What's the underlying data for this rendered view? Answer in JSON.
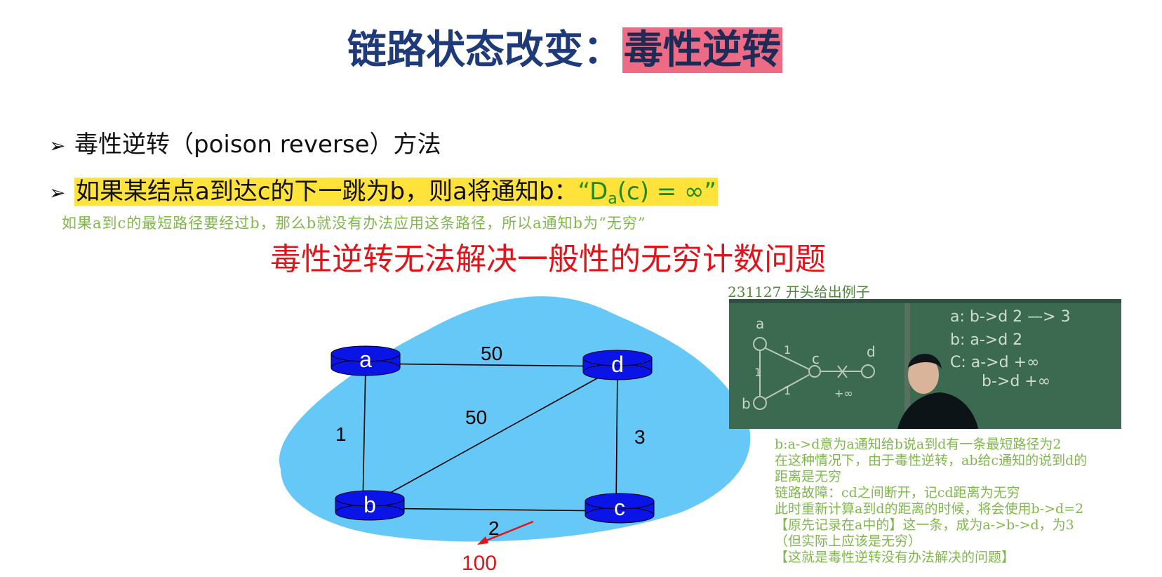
{
  "title": {
    "main": "链路状态改变：",
    "highlight": "毒性逆转"
  },
  "bullets": [
    {
      "marker": "➢",
      "text": "毒性逆转（poison reverse）方法"
    },
    {
      "marker": "➢",
      "text_plain": "如果某结点a到达c的下一跳为b，则a将通知b：",
      "formula_pre": "“D",
      "formula_sub": "a",
      "formula_post": "(c) = ∞”"
    }
  ],
  "note_handwritten": "如果a到c的最短路径要经过b，那么b就没有办法应用这条路径，所以a通知b为“无穷”",
  "warning": "毒性逆转无法解决一般性的无穷计数问题",
  "network": {
    "nodes": [
      "a",
      "d",
      "b",
      "c"
    ],
    "links": [
      {
        "from": "a",
        "to": "d",
        "cost": "50"
      },
      {
        "from": "a",
        "to": "b",
        "cost": "1"
      },
      {
        "from": "b",
        "to": "d",
        "cost": "50"
      },
      {
        "from": "d",
        "to": "c",
        "cost": "3"
      },
      {
        "from": "b",
        "to": "c",
        "cost": "2",
        "changed_to": "100"
      }
    ],
    "colors": {
      "cloud": "#66c8f6",
      "router": "#0a14e6",
      "changed": "#e0141b"
    }
  },
  "video_caption": "231127 开头给出例子",
  "blackboard": {
    "lines": [
      "a: b->d 2 —> 3",
      "b: a->d 2",
      "C: a->d +∞",
      "b->d +∞"
    ],
    "diagram_labels": [
      "a",
      "b",
      "c",
      "d",
      "1",
      "1",
      "1",
      "+∞"
    ]
  },
  "side_notes": [
    "b:a->d意为a通知给b说a到d有一条最短路径为2",
    "在这种情况下，由于毒性逆转，ab给c通知的说到d的",
    "距离是无穷",
    "链路故障：cd之间断开，记cd距离为无穷",
    "此时重新计算a到d的距离的时候，将会使用b->d=2",
    "【原先记录在a中的】这一条，成为a->b->d，为3",
    "（但实际上应该是无穷）",
    "【这就是毒性逆转没有办法解决的问题】"
  ]
}
